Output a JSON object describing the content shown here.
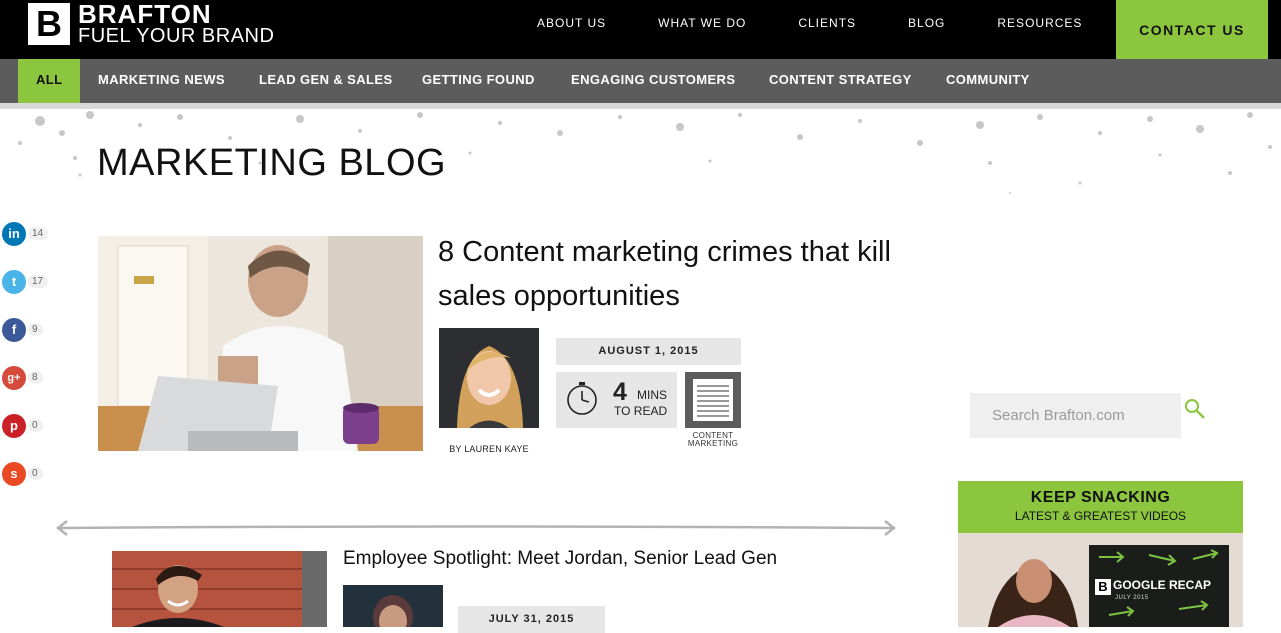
{
  "header": {
    "logo_letter": "B",
    "brand": "BRAFTON",
    "tagline": "FUEL YOUR BRAND",
    "nav": [
      "ABOUT US",
      "WHAT WE DO",
      "CLIENTS",
      "BLOG",
      "RESOURCES"
    ],
    "contact_label": "CONTACT US"
  },
  "categories": [
    "ALL",
    "MARKETING NEWS",
    "LEAD GEN & SALES",
    "GETTING FOUND",
    "ENGAGING CUSTOMERS",
    "CONTENT STRATEGY",
    "COMMUNITY"
  ],
  "page_title": "MARKETING BLOG",
  "shares": [
    {
      "icon": "linkedin-icon",
      "count": "14",
      "color": "#0077b5"
    },
    {
      "icon": "twitter-icon",
      "count": "17",
      "color": "#4ab3e8"
    },
    {
      "icon": "facebook-icon",
      "count": "9",
      "color": "#3b5998"
    },
    {
      "icon": "google-plus-icon",
      "count": "8",
      "color": "#d64a3b"
    },
    {
      "icon": "pinterest-icon",
      "count": "0",
      "color": "#cb2027"
    },
    {
      "icon": "stumbleupon-icon",
      "count": "0",
      "color": "#eb4924"
    }
  ],
  "article1": {
    "title": "8 Content marketing crimes that kill sales opportunities",
    "byline": "BY LAUREN KAYE",
    "date": "AUGUST 1, 2015",
    "mins": "4",
    "mins_label": "MINS",
    "to_read": "TO READ",
    "category_label": "CONTENT MARKETING"
  },
  "article2": {
    "title": "Employee Spotlight: Meet Jordan, Senior Lead Gen",
    "date": "JULY 31, 2015"
  },
  "sidebar": {
    "search_placeholder": "Search Brafton.com",
    "snack_title": "KEEP SNACKING",
    "snack_sub": "LATEST & GREATEST VIDEOS",
    "video_title": "GOOGLE RECAP",
    "video_sub": "JULY 2015",
    "video_logo": "B"
  },
  "colors": {
    "accent": "#8cc63f",
    "header_bg": "#000000",
    "category_bar": "#5c5c5c"
  }
}
